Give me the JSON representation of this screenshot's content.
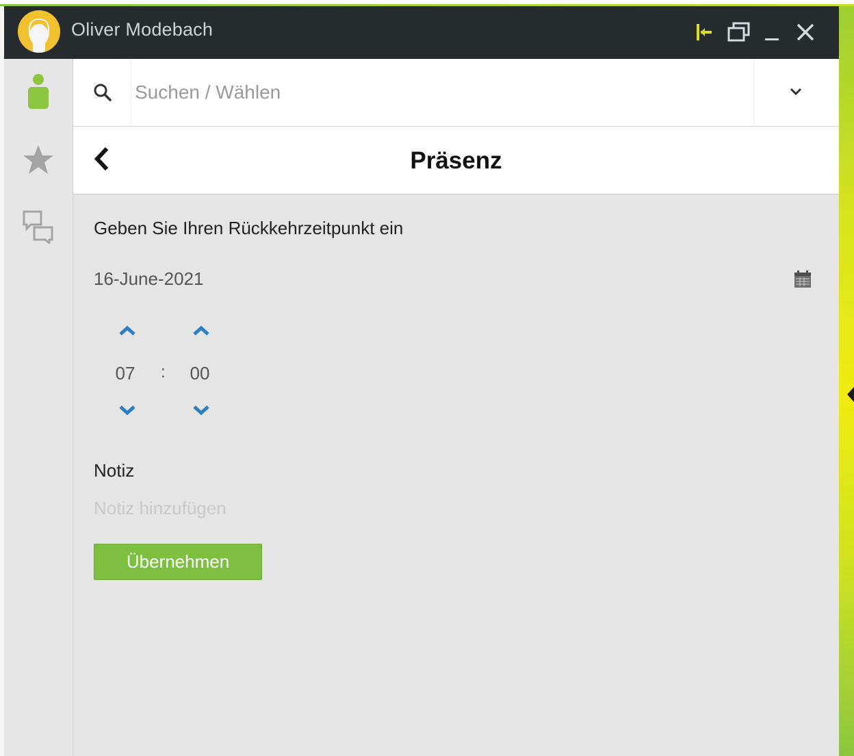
{
  "window": {
    "title": "Oliver Modebach",
    "avatar_icon": "user-avatar-icon",
    "controls": [
      "pin-icon",
      "restore-window-icon",
      "minimize-icon",
      "close-icon"
    ]
  },
  "sidebar": {
    "items": [
      {
        "icon": "person-icon",
        "active": true
      },
      {
        "icon": "star-icon",
        "active": false
      },
      {
        "icon": "chat-bubbles-icon",
        "active": false
      }
    ]
  },
  "search": {
    "placeholder": "Suchen / Wählen",
    "value": ""
  },
  "header": {
    "title": "Präsenz"
  },
  "form": {
    "instruction": "Geben Sie Ihren Rückkehrzeitpunkt ein",
    "date": "16-June-2021",
    "time": {
      "hours": "07",
      "separator": ":",
      "minutes": "00"
    },
    "note_label": "Notiz",
    "note_placeholder": "Notiz hinzufügen",
    "note_value": "",
    "apply_label": "Übernehmen"
  },
  "colors": {
    "titlebar": "#262b2e",
    "accent_green": "#7dbf3f",
    "chevron_blue": "#2d7fc3",
    "content_bg": "#e5e5e5",
    "edge_gradient_mid": "#efec0f"
  }
}
